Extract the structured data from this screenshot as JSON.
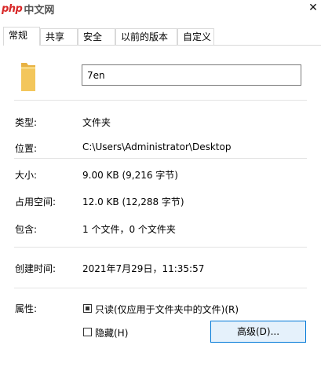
{
  "watermark": {
    "brand_php": "php",
    "brand_cn": "中文网"
  },
  "tabs": [
    {
      "label": "常规",
      "active": true
    },
    {
      "label": "共享"
    },
    {
      "label": "安全"
    },
    {
      "label": "以前的版本"
    },
    {
      "label": "自定义"
    }
  ],
  "general": {
    "name": "7en",
    "type_label": "类型:",
    "type_value": "文件夹",
    "location_label": "位置:",
    "location_value": "C:\\Users\\Administrator\\Desktop",
    "size_label": "大小:",
    "size_value": "9.00 KB (9,216 字节)",
    "size_on_disk_label": "占用空间:",
    "size_on_disk_value": "12.0 KB (12,288 字节)",
    "contains_label": "包含:",
    "contains_value": "1 个文件，0 个文件夹",
    "created_label": "创建时间:",
    "created_value": "2021年7月29日，11:35:57",
    "attributes_label": "属性:",
    "readonly_label": "只读(仅应用于文件夹中的文件)(R)",
    "hidden_label": "隐藏(H)",
    "advanced_button": "高级(D)..."
  },
  "colors": {
    "folder": "#f3c65b",
    "button_border": "#0078d7",
    "button_fill": "#e5f1fb"
  }
}
